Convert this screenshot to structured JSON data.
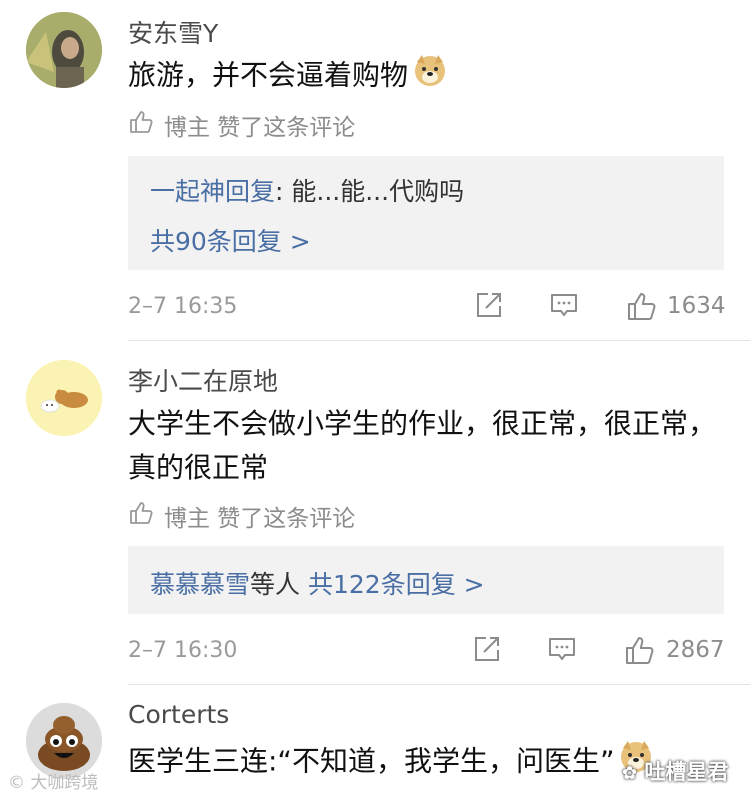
{
  "comments": [
    {
      "username": "安东雪Y",
      "text": "旅游，并不会逼着购物",
      "emoji": "doge-emoji",
      "liked_by_author": "博主 赞了这条评论",
      "reply": {
        "author": "一起神回复",
        "content": ": 能...能...代购吗",
        "more": "共90条回复 >"
      },
      "time": "2–7 16:35",
      "likes": "1634"
    },
    {
      "username": "李小二在原地",
      "text": "大学生不会做小学生的作业，很正常，很正常，真的很正常",
      "liked_by_author": "博主 赞了这条评论",
      "reply": {
        "author": "慕慕慕雪",
        "mid": "等人",
        "more": "共122条回复 >"
      },
      "time": "2–7 16:30",
      "likes": "2867"
    },
    {
      "username": "Corterts",
      "text": "医学生三连:“不知道，我学生，问医生”",
      "emoji": "doge-emoji"
    }
  ],
  "watermarks": {
    "left": "大咖跨境",
    "right": "吐槽星君"
  },
  "colors": {
    "link": "#4a6fa5",
    "meta": "#8c8c8c",
    "reply_bg": "#f2f2f2"
  }
}
